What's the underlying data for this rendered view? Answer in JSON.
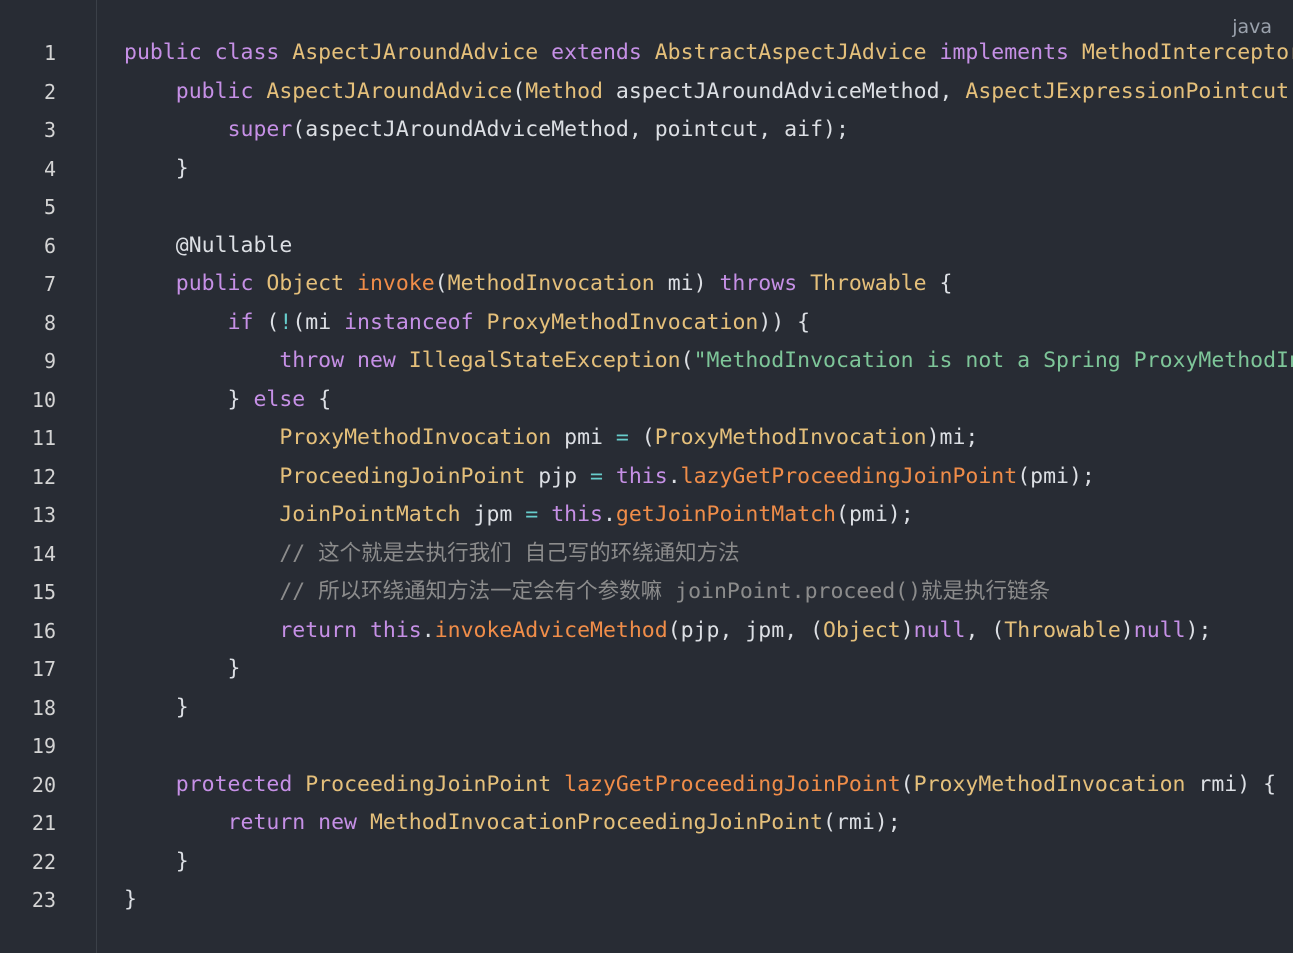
{
  "language_label": "java",
  "line_numbers": [
    "1",
    "2",
    "3",
    "4",
    "5",
    "6",
    "7",
    "8",
    "9",
    "10",
    "11",
    "12",
    "13",
    "14",
    "15",
    "16",
    "17",
    "18",
    "19",
    "20",
    "21",
    "22",
    "23"
  ],
  "lines": [
    [
      [
        "kw",
        "public "
      ],
      [
        "kw",
        "class "
      ],
      [
        "type",
        "AspectJAroundAdvice "
      ],
      [
        "kw",
        "extends "
      ],
      [
        "type",
        "AbstractAspectJAdvice "
      ],
      [
        "kw",
        "implements "
      ],
      [
        "type",
        "MethodInterceptor"
      ]
    ],
    [
      [
        "plain",
        "    "
      ],
      [
        "kw",
        "public "
      ],
      [
        "type",
        "AspectJAroundAdvice"
      ],
      [
        "punc",
        "("
      ],
      [
        "type",
        "Method "
      ],
      [
        "plain",
        "aspectJAroundAdviceMethod, "
      ],
      [
        "type",
        "AspectJExpressionPointcut"
      ]
    ],
    [
      [
        "plain",
        "        "
      ],
      [
        "kw",
        "super"
      ],
      [
        "punc",
        "("
      ],
      [
        "plain",
        "aspectJAroundAdviceMethod, pointcut, aif"
      ],
      [
        "punc",
        ");"
      ]
    ],
    [
      [
        "plain",
        "    }"
      ]
    ],
    [
      [
        "plain",
        ""
      ]
    ],
    [
      [
        "plain",
        "    "
      ],
      [
        "anno",
        "@Nullable"
      ]
    ],
    [
      [
        "plain",
        "    "
      ],
      [
        "kw",
        "public "
      ],
      [
        "type",
        "Object "
      ],
      [
        "fn",
        "invoke"
      ],
      [
        "punc",
        "("
      ],
      [
        "type",
        "MethodInvocation "
      ],
      [
        "plain",
        "mi"
      ],
      [
        "punc",
        ") "
      ],
      [
        "kw",
        "throws "
      ],
      [
        "type",
        "Throwable "
      ],
      [
        "punc",
        "{"
      ]
    ],
    [
      [
        "plain",
        "        "
      ],
      [
        "kw",
        "if "
      ],
      [
        "punc",
        "("
      ],
      [
        "op",
        "!"
      ],
      [
        "punc",
        "("
      ],
      [
        "plain",
        "mi "
      ],
      [
        "kw",
        "instanceof "
      ],
      [
        "type",
        "ProxyMethodInvocation"
      ],
      [
        "punc",
        ")) {"
      ]
    ],
    [
      [
        "plain",
        "            "
      ],
      [
        "kw",
        "throw "
      ],
      [
        "kw",
        "new "
      ],
      [
        "type",
        "IllegalStateException"
      ],
      [
        "punc",
        "("
      ],
      [
        "str",
        "\"MethodInvocation is not a Spring ProxyMethodInvocation\""
      ]
    ],
    [
      [
        "plain",
        "        } "
      ],
      [
        "kw",
        "else "
      ],
      [
        "punc",
        "{"
      ]
    ],
    [
      [
        "plain",
        "            "
      ],
      [
        "type",
        "ProxyMethodInvocation "
      ],
      [
        "plain",
        "pmi "
      ],
      [
        "op",
        "= "
      ],
      [
        "punc",
        "("
      ],
      [
        "type",
        "ProxyMethodInvocation"
      ],
      [
        "punc",
        ")"
      ],
      [
        "plain",
        "mi;"
      ]
    ],
    [
      [
        "plain",
        "            "
      ],
      [
        "type",
        "ProceedingJoinPoint "
      ],
      [
        "plain",
        "pjp "
      ],
      [
        "op",
        "= "
      ],
      [
        "kw",
        "this"
      ],
      [
        "punc",
        "."
      ],
      [
        "fn",
        "lazyGetProceedingJoinPoint"
      ],
      [
        "punc",
        "("
      ],
      [
        "plain",
        "pmi"
      ],
      [
        "punc",
        ");"
      ]
    ],
    [
      [
        "plain",
        "            "
      ],
      [
        "type",
        "JoinPointMatch "
      ],
      [
        "plain",
        "jpm "
      ],
      [
        "op",
        "= "
      ],
      [
        "kw",
        "this"
      ],
      [
        "punc",
        "."
      ],
      [
        "fn",
        "getJoinPointMatch"
      ],
      [
        "punc",
        "("
      ],
      [
        "plain",
        "pmi"
      ],
      [
        "punc",
        ");"
      ]
    ],
    [
      [
        "plain",
        "            "
      ],
      [
        "cmt",
        "// 这个就是去执行我们 自己写的环绕通知方法"
      ]
    ],
    [
      [
        "plain",
        "            "
      ],
      [
        "cmt",
        "// 所以环绕通知方法一定会有个参数嘛 joinPoint.proceed()就是执行链条"
      ]
    ],
    [
      [
        "plain",
        "            "
      ],
      [
        "kw",
        "return "
      ],
      [
        "kw",
        "this"
      ],
      [
        "punc",
        "."
      ],
      [
        "fn",
        "invokeAdviceMethod"
      ],
      [
        "punc",
        "("
      ],
      [
        "plain",
        "pjp, jpm, "
      ],
      [
        "punc",
        "("
      ],
      [
        "type",
        "Object"
      ],
      [
        "punc",
        ")"
      ],
      [
        "kw",
        "null"
      ],
      [
        "punc",
        ", ("
      ],
      [
        "type",
        "Throwable"
      ],
      [
        "punc",
        ")"
      ],
      [
        "kw",
        "null"
      ],
      [
        "punc",
        ");"
      ]
    ],
    [
      [
        "plain",
        "        }"
      ]
    ],
    [
      [
        "plain",
        "    }"
      ]
    ],
    [
      [
        "plain",
        ""
      ]
    ],
    [
      [
        "plain",
        "    "
      ],
      [
        "kw",
        "protected "
      ],
      [
        "type",
        "ProceedingJoinPoint "
      ],
      [
        "fn",
        "lazyGetProceedingJoinPoint"
      ],
      [
        "punc",
        "("
      ],
      [
        "type",
        "ProxyMethodInvocation "
      ],
      [
        "plain",
        "rmi"
      ],
      [
        "punc",
        ") {"
      ]
    ],
    [
      [
        "plain",
        "        "
      ],
      [
        "kw",
        "return "
      ],
      [
        "kw",
        "new "
      ],
      [
        "type",
        "MethodInvocationProceedingJoinPoint"
      ],
      [
        "punc",
        "("
      ],
      [
        "plain",
        "rmi"
      ],
      [
        "punc",
        ");"
      ]
    ],
    [
      [
        "plain",
        "    }"
      ]
    ],
    [
      [
        "plain",
        "}"
      ]
    ]
  ]
}
